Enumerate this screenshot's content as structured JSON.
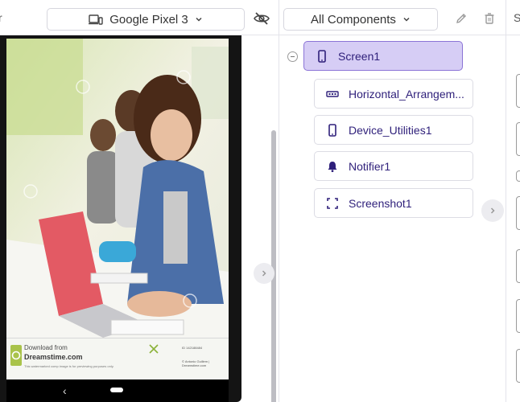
{
  "toolbar": {
    "left_edge_text": "r",
    "device_select": "Google Pixel 3",
    "component_select": "All Components",
    "right_edge_text": "S"
  },
  "watermark": {
    "line1": "Download from",
    "line2": "Dreamstime.com",
    "line3": "This watermarked comp image is for previewing purposes only.",
    "id_text": "ID 142188484",
    "credit_text": "© Antonio Guillem | Dreamstime.com"
  },
  "tree": {
    "root": {
      "label": "Screen1",
      "icon": "phone-icon"
    },
    "children": [
      {
        "label": "Horizontal_Arrangem...",
        "icon": "horizontal-arrangement-icon"
      },
      {
        "label": "Device_Utilities1",
        "icon": "device-utilities-icon"
      },
      {
        "label": "Notifier1",
        "icon": "bell-icon"
      },
      {
        "label": "Screenshot1",
        "icon": "screenshot-icon"
      }
    ]
  },
  "colors": {
    "accent": "#3b2a8a",
    "selected_bg": "#d6cdf5",
    "selected_border": "#8b74d6"
  }
}
